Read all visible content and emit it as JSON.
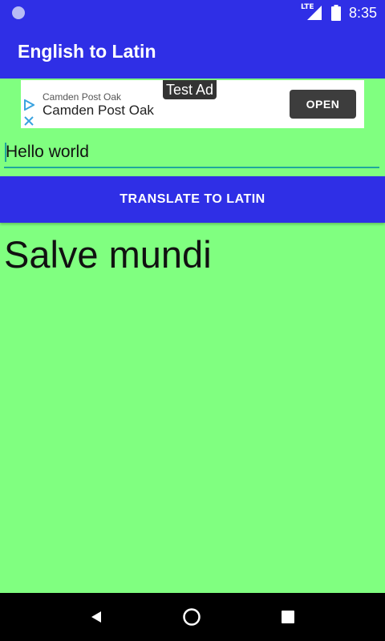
{
  "status_bar": {
    "network": "LTE",
    "time": "8:35",
    "icons": [
      "notification-dot-icon",
      "lte-signal-icon",
      "battery-icon"
    ]
  },
  "app_bar": {
    "title": "English to Latin"
  },
  "ad": {
    "badge": "Test Ad",
    "line1": "Camden Post Oak",
    "line2": "Camden Post Oak",
    "button": "OPEN",
    "icons": [
      "ad-choices-play-icon",
      "ad-close-icon"
    ]
  },
  "input": {
    "value": "Hello world"
  },
  "translate_button": {
    "label": "TRANSLATE TO LATIN"
  },
  "result": {
    "text": "Salve mundi"
  },
  "nav_bar": {
    "icons": [
      "back-icon",
      "home-icon",
      "recent-apps-icon"
    ]
  },
  "colors": {
    "primary": "#2f2fe6",
    "background": "#80ff80",
    "accent": "#1fa79c",
    "nav_bar": "#000000"
  }
}
